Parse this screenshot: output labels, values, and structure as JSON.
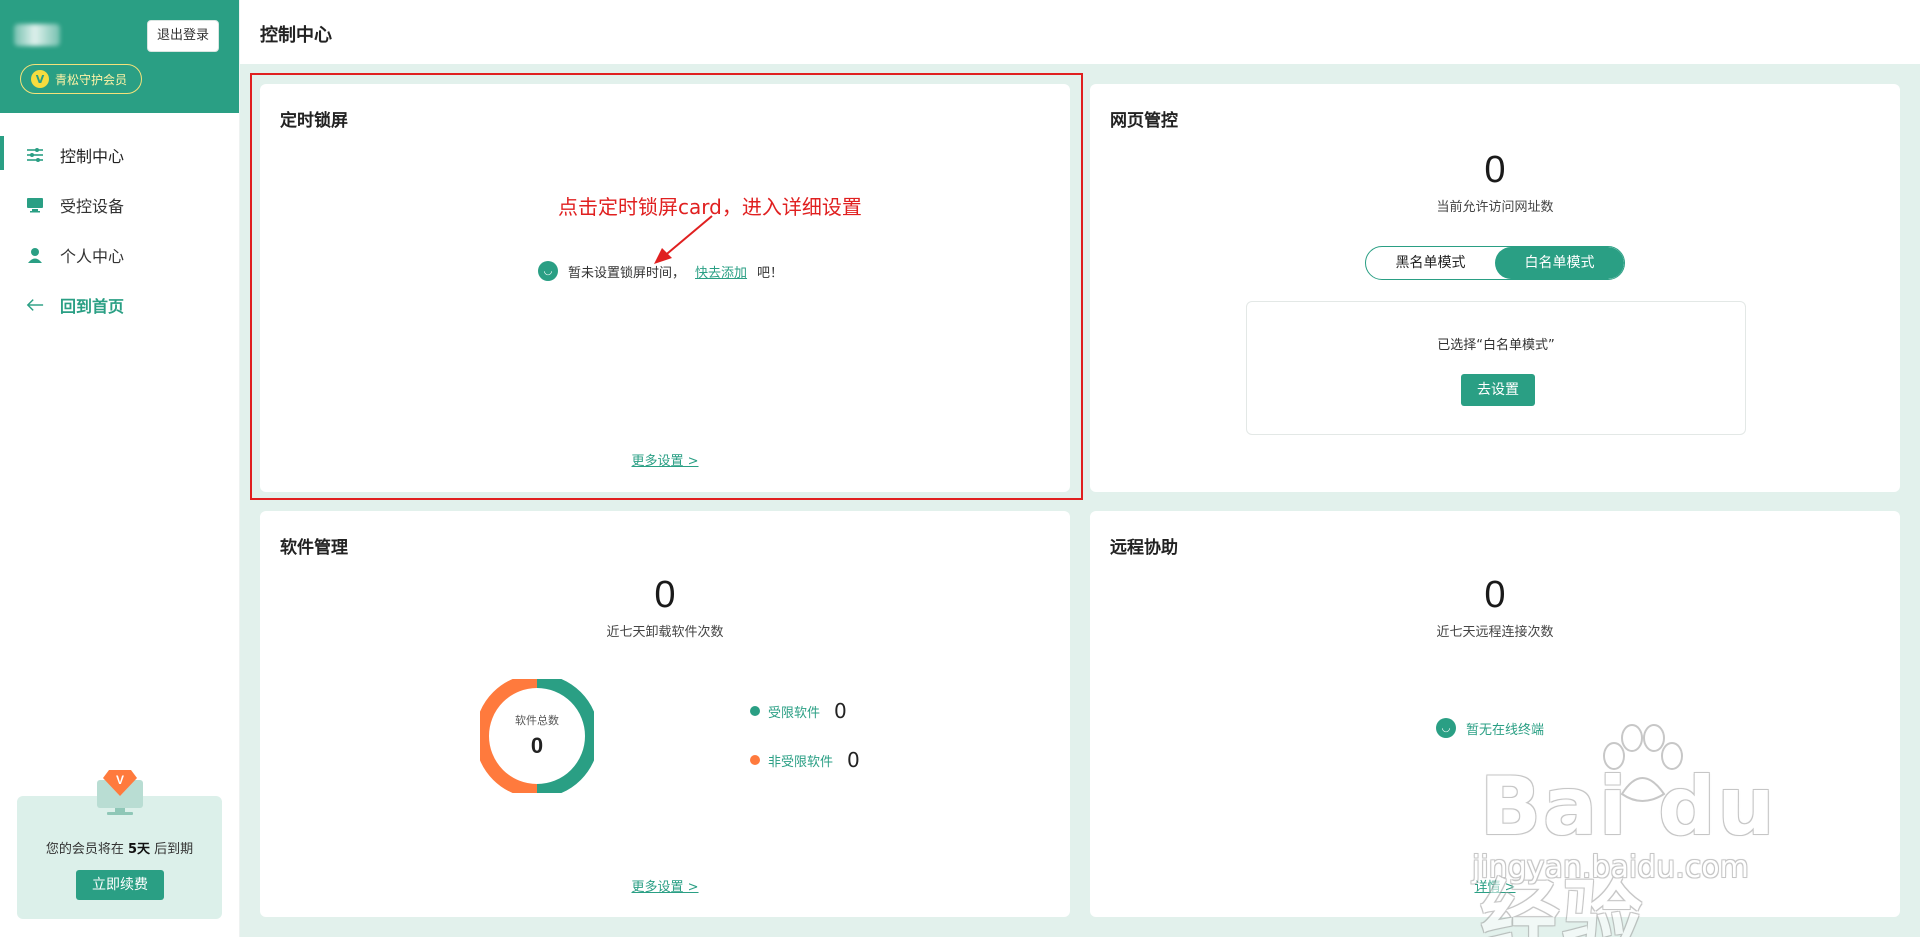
{
  "sidebar": {
    "logout_label": "退出登录",
    "vip_label": "青松守护会员",
    "nav": [
      {
        "label": "控制中心",
        "icon": "sliders-icon"
      },
      {
        "label": "受控设备",
        "icon": "monitor-icon"
      },
      {
        "label": "个人中心",
        "icon": "user-icon"
      },
      {
        "label": "回到首页",
        "icon": "arrow-left-icon"
      }
    ],
    "member": {
      "text_prefix": "您的会员将在",
      "days": "5天",
      "text_suffix": "后到期",
      "renew_label": "立即续费"
    }
  },
  "header": {
    "title": "控制中心"
  },
  "lock_card": {
    "title": "定时锁屏",
    "annotation": "点击定时锁屏card，进入详细设置",
    "empty_text": "暂未设置锁屏时间，",
    "quick_add": "快去添加",
    "empty_suffix": "吧！",
    "more": "更多设置 >"
  },
  "web_card": {
    "title": "网页管控",
    "count": "0",
    "count_label": "当前允许访问网址数",
    "mode_black": "黑名单模式",
    "mode_white": "白名单模式",
    "selected_text": "已选择“白名单模式”",
    "goset": "去设置"
  },
  "soft_card": {
    "title": "软件管理",
    "count": "0",
    "count_label": "近七天卸载软件次数",
    "donut_label": "软件总数",
    "donut_value": "0",
    "limited_label": "受限软件",
    "limited_value": "0",
    "unlimited_label": "非受限软件",
    "unlimited_value": "0",
    "more": "更多设置 >"
  },
  "remote_card": {
    "title": "远程协助",
    "count": "0",
    "count_label": "近七天远程连接次数",
    "offline": "暂无在线终端",
    "more": "详情 >"
  },
  "watermark": {
    "main": "Bai du 经验",
    "sub": "jingyan.baidu.com"
  },
  "colors": {
    "primary": "#2a9f84",
    "accent_orange": "#ff7a3d",
    "annotation_red": "#e02020",
    "page_bg": "#e2f1ec"
  }
}
